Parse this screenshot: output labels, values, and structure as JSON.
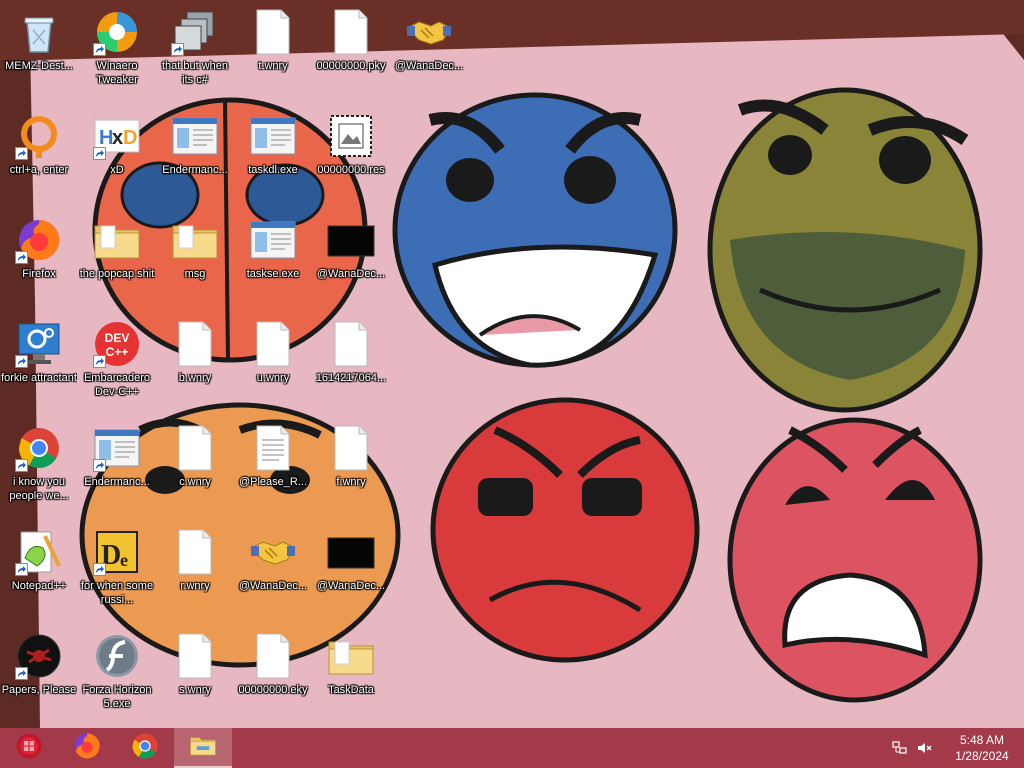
{
  "desktop": {
    "icons": [
      {
        "label": "MEMZ-Dest...",
        "icon": "recycle-bin-icon",
        "shortcut": false
      },
      {
        "label": "Winaero Tweaker",
        "icon": "winaero-icon",
        "shortcut": true
      },
      {
        "label": "that but when its c#",
        "icon": "stacked-windows-icon",
        "shortcut": true
      },
      {
        "label": "t.wnry",
        "icon": "blank-file-icon",
        "shortcut": false
      },
      {
        "label": "00000000.pky",
        "icon": "blank-file-icon",
        "shortcut": false
      },
      {
        "label": "@WanaDec...",
        "icon": "handshake-icon",
        "shortcut": false
      },
      {
        "label": "ctrl+a, enter",
        "icon": "orange-ring-icon",
        "shortcut": true
      },
      {
        "label": "xD",
        "icon": "hxd-icon",
        "shortcut": true
      },
      {
        "label": "Endermanc...",
        "icon": "app-window-icon",
        "shortcut": false
      },
      {
        "label": "taskdl.exe",
        "icon": "app-window-icon",
        "shortcut": false
      },
      {
        "label": "00000000.res",
        "icon": "image-file-icon",
        "shortcut": false
      },
      {
        "label": "Firefox",
        "icon": "firefox-icon",
        "shortcut": true
      },
      {
        "label": "the popcap shit",
        "icon": "folder-icon",
        "shortcut": false
      },
      {
        "label": "msg",
        "icon": "folder-icon",
        "shortcut": false
      },
      {
        "label": "taskse.exe",
        "icon": "app-window-icon",
        "shortcut": false
      },
      {
        "label": "@WanaDec...",
        "icon": "black-image-icon",
        "shortcut": false
      },
      {
        "label": "forkie attractant",
        "icon": "computer-settings-icon",
        "shortcut": true
      },
      {
        "label": "Embarcadero Dev-C++",
        "icon": "devcpp-icon",
        "shortcut": true
      },
      {
        "label": "b.wnry",
        "icon": "blank-file-icon",
        "shortcut": false
      },
      {
        "label": "u.wnry",
        "icon": "blank-file-icon",
        "shortcut": false
      },
      {
        "label": "1614217064...",
        "icon": "blank-file-icon",
        "shortcut": false
      },
      {
        "label": "i know you people we...",
        "icon": "chrome-icon",
        "shortcut": true
      },
      {
        "label": "Endermanc...",
        "icon": "app-window-icon",
        "shortcut": true
      },
      {
        "label": "c.wnry",
        "icon": "blank-file-icon",
        "shortcut": false
      },
      {
        "label": "@Please_R...",
        "icon": "text-file-icon",
        "shortcut": false
      },
      {
        "label": "f.wnry",
        "icon": "blank-file-icon",
        "shortcut": false
      },
      {
        "label": "Notepad++",
        "icon": "notepadpp-icon",
        "shortcut": true
      },
      {
        "label": "for when some russi...",
        "icon": "de-icon",
        "shortcut": true
      },
      {
        "label": "r.wnry",
        "icon": "blank-file-icon",
        "shortcut": false
      },
      {
        "label": "@WanaDec...",
        "icon": "handshake-icon",
        "shortcut": false
      },
      {
        "label": "@WanaDec...",
        "icon": "black-image-icon",
        "shortcut": false
      },
      {
        "label": "Papers, Please",
        "icon": "papers-please-icon",
        "shortcut": true
      },
      {
        "label": "Forza Horizon 5.exe",
        "icon": "flash-icon",
        "shortcut": false
      },
      {
        "label": "s.wnry",
        "icon": "blank-file-icon",
        "shortcut": false
      },
      {
        "label": "00000000.eky",
        "icon": "blank-file-icon",
        "shortcut": false
      },
      {
        "label": "TaskData",
        "icon": "folder-icon",
        "shortcut": false
      }
    ]
  },
  "taskbar": {
    "background": "#a23a4a",
    "buttons": [
      {
        "name": "start-button",
        "icon": "start-orb-icon",
        "active": false
      },
      {
        "name": "taskbar-firefox",
        "icon": "firefox-icon",
        "active": false
      },
      {
        "name": "taskbar-chrome",
        "icon": "chrome-icon",
        "active": false
      },
      {
        "name": "taskbar-file-explorer",
        "icon": "file-explorer-icon",
        "active": true
      }
    ],
    "tray": {
      "icons": [
        "network-icon",
        "volume-muted-icon"
      ],
      "time": "5:48 AM",
      "date": "1/28/2024"
    }
  }
}
